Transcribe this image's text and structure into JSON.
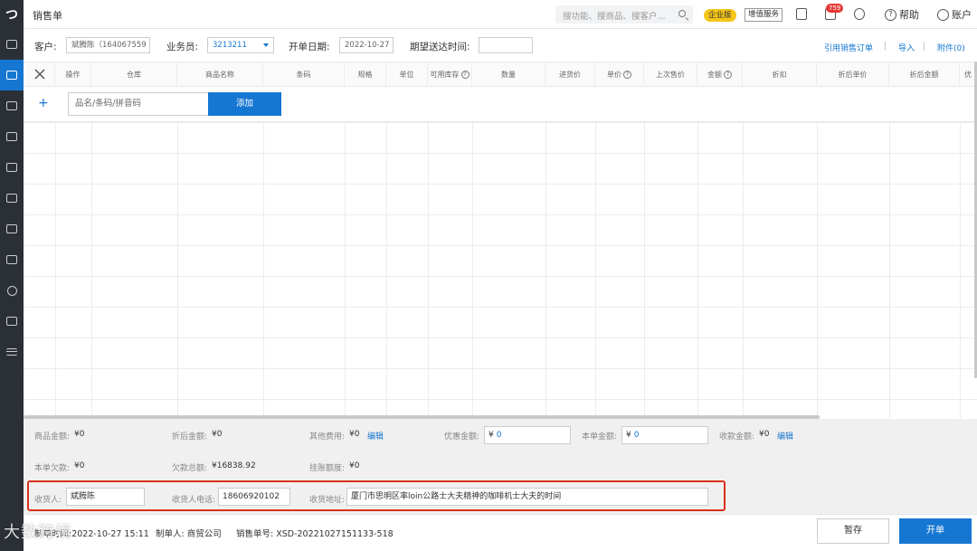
{
  "sidebar": {
    "logo": "つ"
  },
  "topbar": {
    "title": "销售单",
    "search_placeholder": "搜功能、搜商品、搜客户...",
    "edition_badge": "企业版",
    "value_added_label": "增值服务",
    "notification_count": "759",
    "help_label": "帮助",
    "account_label": "账户"
  },
  "header": {
    "customer_label": "客户:",
    "customer_value": "斌腾陈（164067559",
    "salesperson_label": "业务员:",
    "salesperson_value": "3213211",
    "date_label": "开单日期:",
    "date_value": "2022-10-27",
    "delivery_label": "期望送达时间:",
    "delivery_value": "",
    "links": {
      "ref_order": "引用销售订单",
      "import": "导入",
      "attachment": "附件(0)"
    }
  },
  "table": {
    "columns": [
      "操作",
      "仓库",
      "商品名称",
      "条码",
      "规格",
      "单位",
      "可用库存",
      "数量",
      "进货价",
      "单价",
      "上次售价",
      "金额",
      "折扣",
      "折后单价",
      "折后金额",
      "优"
    ],
    "add_placeholder": "品名/条码/拼音码",
    "add_button": "添加"
  },
  "summary": {
    "goods_amount_label": "商品金额:",
    "goods_amount": "¥0",
    "discounted_amount_label": "折后金额:",
    "discounted_amount": "¥0",
    "other_fees_label": "其他费用:",
    "other_fees": "¥0",
    "edit1": "编辑",
    "preferential_label": "优惠金额:",
    "preferential_yen": "¥",
    "preferential_value": "0",
    "order_amount_label": "本单金额:",
    "order_amount_yen": "¥",
    "order_amount_value": "0",
    "received_label": "收款金额:",
    "received": "¥0",
    "edit2": "编辑",
    "order_debt_label": "本单欠款:",
    "order_debt": "¥0",
    "total_debt_label": "欠款总额:",
    "total_debt": "¥16838.92",
    "credit_label": "挂账额度:",
    "credit": "¥0",
    "receiver_label": "收货人:",
    "receiver": "斌腾陈",
    "receiver_phone_label": "收货人电话:",
    "receiver_phone": "18606920102",
    "address_label": "收货地址:",
    "address": "厦门市思明区率loin公路士大夫精神的咖啡机士大夫的时间"
  },
  "footer": {
    "create_time": "制单时间:2022-10-27 15:11",
    "creator": "制单人: 商贸公司",
    "order_no": "销售单号: XSD-20221027151133-518",
    "save_button": "暂存",
    "submit_button": "开单",
    "watermark": "大数跨境"
  }
}
